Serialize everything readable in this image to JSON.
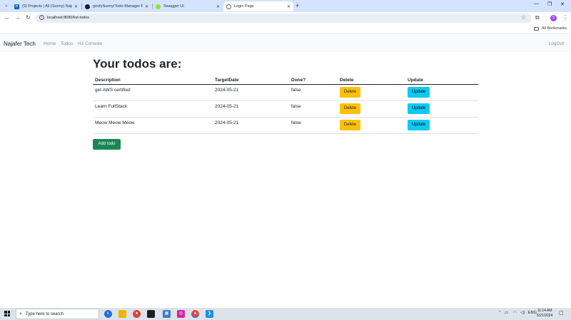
{
  "browser": {
    "tabs": [
      {
        "title": "(5) Projects | Ali (Sunny) Najafi...",
        "icon": "linkedin-icon",
        "color": "#0a66c2"
      },
      {
        "title": "goofySunny/Todo-Manager-Fu...",
        "icon": "github-icon",
        "color": "#1b1f23"
      },
      {
        "title": "Swagger UI",
        "icon": "swagger-icon",
        "color": "#85ea2d"
      },
      {
        "title": "Login Page",
        "icon": "globe-icon",
        "color": "#5f6368"
      }
    ],
    "url": "localhost:8080/list-todos",
    "profile_initial": "S",
    "bookmarks_label": "All Bookmarks"
  },
  "app": {
    "brand": "Najafer Tech",
    "nav": [
      "Home",
      "Todos",
      "H2 Console"
    ],
    "logout": "LogOut"
  },
  "page": {
    "heading": "Your todos are:",
    "columns": [
      "Description",
      "TargetDate",
      "Done?",
      "Delete",
      "Update"
    ],
    "todos": [
      {
        "description": "get AWS certified",
        "target_date": "2024-05-21",
        "done": "false",
        "delete_label": "Delete",
        "update_label": "Update"
      },
      {
        "description": "Learn FullStack",
        "target_date": "2024-05-21",
        "done": "false",
        "delete_label": "Delete",
        "update_label": "Update"
      },
      {
        "description": "Meow Meow Meow",
        "target_date": "2024-05-21",
        "done": "false",
        "delete_label": "Delete",
        "update_label": "Update"
      }
    ],
    "add_label": "Add todo"
  },
  "taskbar": {
    "search_placeholder": "Type here to search",
    "lang": "ENG",
    "time": "11:14 AM",
    "date": "5/21/2024"
  },
  "colors": {
    "warning": "#ffc107",
    "info": "#0dcaf0",
    "success": "#198754"
  }
}
